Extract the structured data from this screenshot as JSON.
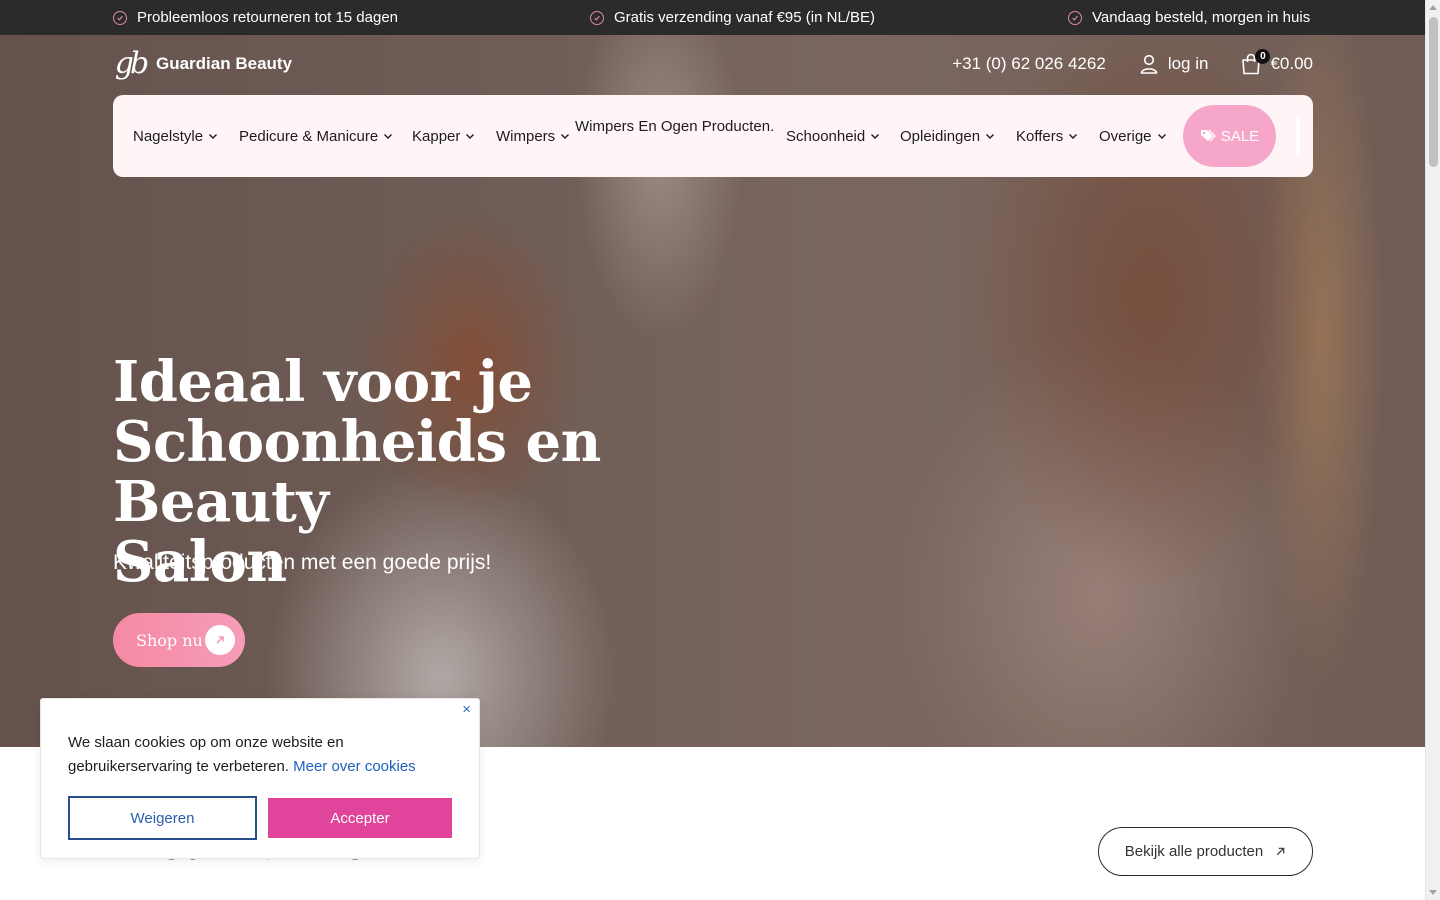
{
  "topbar": {
    "usps": [
      "Probleemloos retourneren tot 15 dagen",
      "Gratis verzending vanaf €95 (in NL/BE)",
      "Vandaag besteld, morgen in huis"
    ]
  },
  "header": {
    "logo_mark": "gb",
    "brand": "Guardian Beauty",
    "phone": "+31 (0) 62 026 4262",
    "login_label": "log in",
    "cart_count": "0",
    "cart_total": "€0.00"
  },
  "nav": {
    "items": [
      "Nagelstyle",
      "Pedicure & Manicure",
      "Kapper",
      "Wimpers",
      "Wimpers En Ogen Producten.",
      "Schoonheid",
      "Opleidingen",
      "Koffers",
      "Overige"
    ],
    "sale_label": "SALE"
  },
  "hero": {
    "title_lines": [
      "Ideaal voor je",
      "Schoonheids en Beauty",
      "Salon"
    ],
    "subtitle": "Kwaliteitsproducten met een goede prijs!",
    "cta": "Shop nu"
  },
  "section": {
    "title": "Nieuw binnen",
    "all_products": "Bekijk alle producten"
  },
  "cookie": {
    "message": "We slaan cookies op om onze website en gebruikerservaring te verbeteren.",
    "link": "Meer over cookies",
    "decline": "Weigeren",
    "accept": "Accepter",
    "close": "×"
  },
  "colors": {
    "topbar_bg": "#2b2b2b",
    "nav_bg": "#fff5f7",
    "sale_bg": "#f6a6c8",
    "cta_pink": "#f58aa4",
    "accept_bg": "#e0459b",
    "link_blue": "#1f5fbf"
  },
  "icons": {
    "usp": "check-circle-icon",
    "login": "user-icon",
    "cart": "shopping-bag-icon",
    "sale": "tags-icon",
    "cta": "arrow-up-right-icon"
  }
}
